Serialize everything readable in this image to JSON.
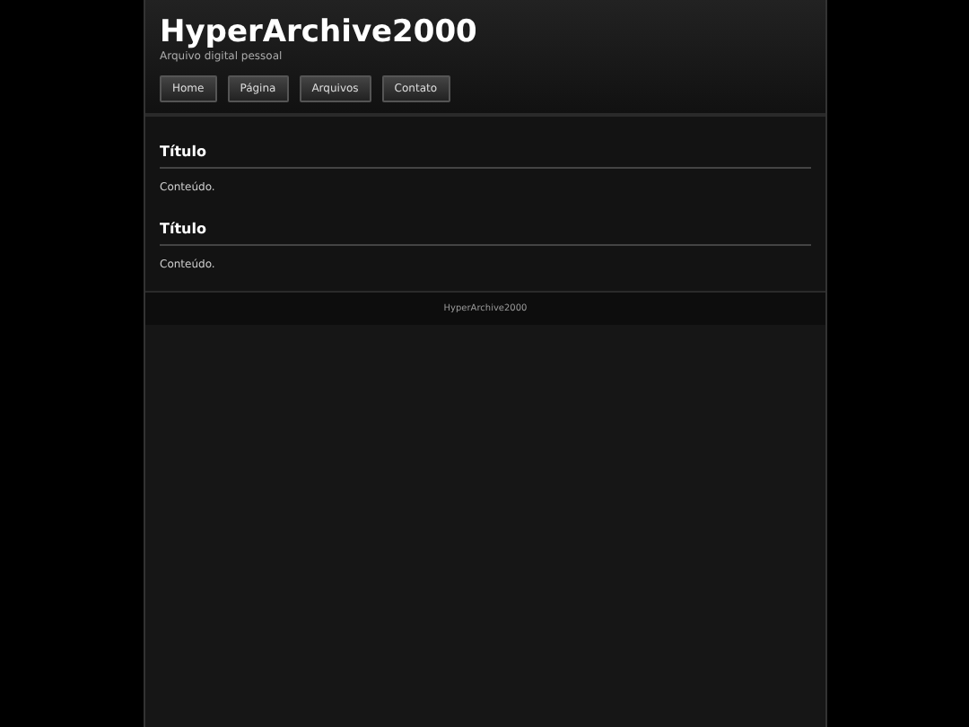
{
  "site": {
    "title": "HyperArchive2000",
    "tagline": "Arquivo digital pessoal"
  },
  "nav": [
    {
      "label": "Home"
    },
    {
      "label": "Página"
    },
    {
      "label": "Arquivos"
    },
    {
      "label": "Contato"
    }
  ],
  "posts": [
    {
      "title": "Título",
      "body": "Conteúdo."
    },
    {
      "title": "Título",
      "body": "Conteúdo."
    }
  ],
  "footer": "HyperArchive2000"
}
